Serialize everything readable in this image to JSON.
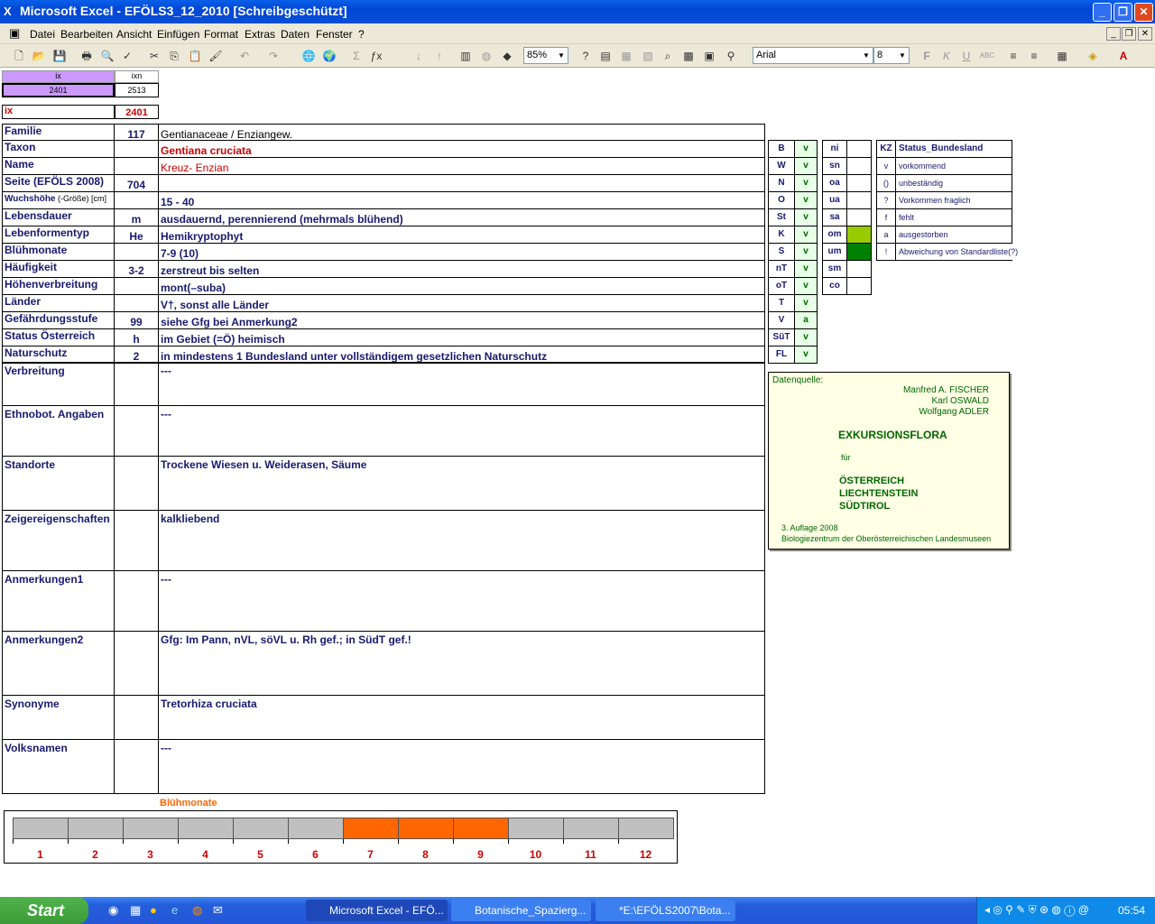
{
  "window": {
    "title": "Microsoft Excel - EFÖLS3_12_2010  [Schreibgeschützt]"
  },
  "menu": [
    "Datei",
    "Bearbeiten",
    "Ansicht",
    "Einfügen",
    "Format",
    "Extras",
    "Daten",
    "Fenster",
    "?"
  ],
  "toolbar": {
    "zoom": "85%",
    "font": "Arial",
    "size": "8"
  },
  "header_cells": {
    "ix_label": "ix",
    "ixn_label": "ixn",
    "ix_value": "2401",
    "ixn_value": "2513",
    "ix_red_label": "ix",
    "ix_red_value": "2401"
  },
  "rows": [
    {
      "label": "Familie",
      "num": "117",
      "value": "Gentianaceae  /  Enziangew."
    },
    {
      "label": "Taxon",
      "num": "",
      "value": "Gentiana cruciata"
    },
    {
      "label": "Name",
      "num": "",
      "value": "Kreuz- Enzian"
    },
    {
      "label": "Seite (EFÖLS 2008)",
      "num": "704",
      "value": ""
    },
    {
      "label": "Wuchshöhe",
      "label_suffix": " (-Größe) [cm]",
      "num": "",
      "value": " 15 - 40"
    },
    {
      "label": "Lebensdauer",
      "num": "m",
      "value": "ausdauernd, perennierend (mehrmals blühend)"
    },
    {
      "label": "Lebenformentyp",
      "num": "He",
      "value": "Hemikryptophyt"
    },
    {
      "label": "Blühmonate",
      "num": "",
      "value": " 7-9 (10)"
    },
    {
      "label": "Häufigkeit",
      "num": "3-2",
      "value": "zerstreut bis selten"
    },
    {
      "label": "Höhenverbreitung",
      "num": "",
      "value": "mont(–suba)"
    },
    {
      "label": "Länder",
      "num": "",
      "value": "V†, sonst alle Länder"
    },
    {
      "label": "Gefährdungsstufe",
      "num": "99",
      "value": "siehe Gfg bei Anmerkung2"
    },
    {
      "label": "Status Österreich",
      "num": "h",
      "value": "im Gebiet (=Ö) heimisch"
    },
    {
      "label": "Naturschutz",
      "num": "2",
      "value": "in mindestens 1 Bundesland unter vollständigem gesetzlichen Naturschutz"
    }
  ],
  "tall_rows": [
    {
      "label": "Verbreitung",
      "value": " ---"
    },
    {
      "label": "Ethnobot. Angaben",
      "value": "---"
    },
    {
      "label": "Standorte",
      "value": "Trockene Wiesen u. Weiderasen, Säume"
    },
    {
      "label": "Zeigereigenschaften",
      "value": "kalkliebend"
    },
    {
      "label": "Anmerkungen1",
      "value": "---"
    },
    {
      "label": "Anmerkungen2",
      "value": "Gfg:  Im Pann, nVL, söVL u. Rh gef.; in SüdT gef.!"
    },
    {
      "label": "Synonyme",
      "value": "Tretorhiza cruciata"
    },
    {
      "label": "Volksnamen",
      "value": "---"
    }
  ],
  "laender": [
    {
      "k": "B",
      "v": "v"
    },
    {
      "k": "W",
      "v": "v"
    },
    {
      "k": "N",
      "v": "v"
    },
    {
      "k": "O",
      "v": "v"
    },
    {
      "k": "St",
      "v": "v"
    },
    {
      "k": "K",
      "v": "v"
    },
    {
      "k": "S",
      "v": "v"
    },
    {
      "k": "nT",
      "v": "v"
    },
    {
      "k": "oT",
      "v": "v"
    },
    {
      "k": "T",
      "v": "v"
    },
    {
      "k": "V",
      "v": "a"
    },
    {
      "k": "SüT",
      "v": "v"
    },
    {
      "k": "FL",
      "v": "v"
    }
  ],
  "hoehen": [
    {
      "k": "ni",
      "fill": ""
    },
    {
      "k": "sn",
      "fill": ""
    },
    {
      "k": "oa",
      "fill": ""
    },
    {
      "k": "ua",
      "fill": ""
    },
    {
      "k": "sa",
      "fill": ""
    },
    {
      "k": "om",
      "fill": "#99cc00"
    },
    {
      "k": "um",
      "fill": "#008000"
    },
    {
      "k": "sm",
      "fill": ""
    },
    {
      "k": "co",
      "fill": ""
    }
  ],
  "kz": {
    "header_k": "KZ",
    "header_v": "Status_Bundesland",
    "items": [
      {
        "k": "v",
        "v": "vorkommend"
      },
      {
        "k": "()",
        "v": "unbeständig"
      },
      {
        "k": "?",
        "v": "Vorkommen fraglich"
      },
      {
        "k": "f",
        "v": "fehlt"
      },
      {
        "k": "a",
        "v": "ausgestorben"
      },
      {
        "k": "!",
        "v": "Abweichung von Standardliste(?)"
      }
    ]
  },
  "datenquelle": {
    "label": "Datenquelle:",
    "authors": [
      "Manfred A. FISCHER",
      "Karl OSWALD",
      "Wolfgang ADLER"
    ],
    "title": "EXKURSIONSFLORA",
    "fuer": "für",
    "countries": [
      "ÖSTERREICH",
      "LIECHTENSTEIN",
      "SÜDTIROL"
    ],
    "edition": "3. Auflage 2008",
    "publisher": "Biologiezentrum der Oberösterreichischen Landesmuseen"
  },
  "chart_data": {
    "type": "bar",
    "title": "Blühmonate",
    "categories": [
      "1",
      "2",
      "3",
      "4",
      "5",
      "6",
      "7",
      "8",
      "9",
      "10",
      "11",
      "12"
    ],
    "values": [
      0,
      0,
      0,
      0,
      0,
      0,
      1,
      1,
      1,
      0,
      0,
      0
    ],
    "colors": {
      "on": "#ff6600",
      "off": "#c0c0c0"
    }
  },
  "taskbar": {
    "start": "Start",
    "tasks": [
      "Microsoft Excel - EFÖ...",
      "Botanische_Spazierg...",
      "*E:\\EFÖLS2007\\Bota..."
    ],
    "clock": "05:54"
  }
}
